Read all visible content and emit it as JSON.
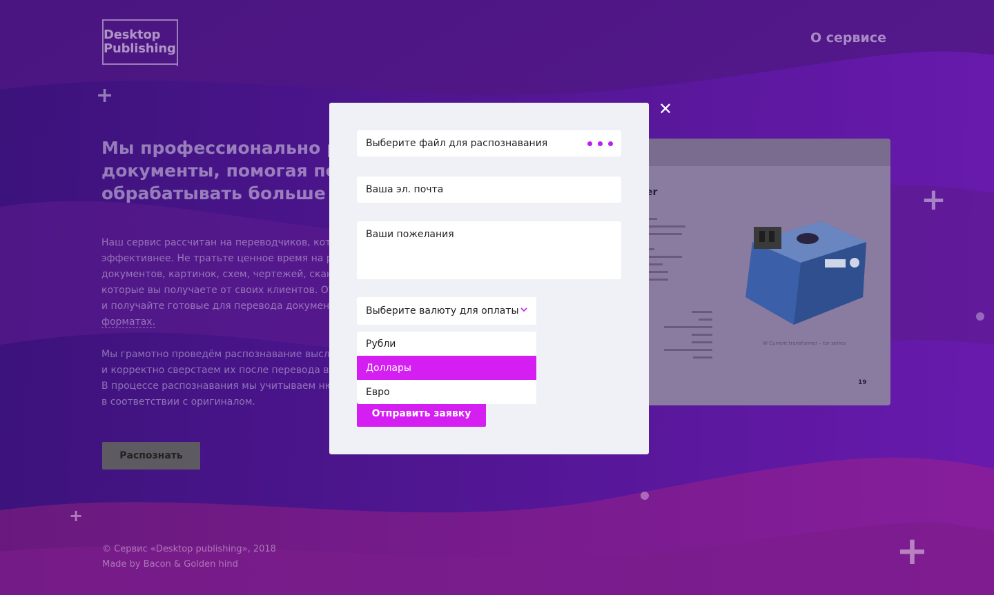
{
  "brand": {
    "logo_line1": "Desktop",
    "logo_line2": "Publishing"
  },
  "nav": {
    "about_label": "О сервисе"
  },
  "hero": {
    "title_lines": [
      "Мы профессионально распознаём",
      "документы, помогая переводчикам",
      "обрабатывать больше заказов"
    ],
    "paragraph1_lines": [
      "Наш сервис рассчитан на переводчиков, которые",
      "эффективнее. Не тратьте ценное время на распознавание",
      "документов, картинок, схем, чертежей, сканов",
      "которые вы получаете от своих клиентов. Отправьте",
      "и получайте готовые для перевода документы",
      "форматах."
    ],
    "paragraph2_lines": [
      "Мы грамотно проведём распознавание высланных",
      "и корректно сверстаем их после перевода в сл",
      "В процессе распознавания мы учитываем нюансы",
      "в соответствии с оригиналом."
    ],
    "button_label": "Распознать"
  },
  "preview": {
    "heading": "er",
    "caption": "W Current transformer – tor series",
    "page_number": "19"
  },
  "footer": {
    "copyright": "© Сервис «Desktop publishing», 2018",
    "made_by": "Made by Bacon & Golden hind"
  },
  "modal": {
    "file_placeholder": "Выберите файл для распознавания",
    "email_placeholder": "Ваша эл. почта",
    "wishes_placeholder": "Ваши пожелания",
    "currency_select_label": "Выберите валюту для оплаты",
    "currency_options": [
      "Рубли",
      "Доллары",
      "Евро"
    ],
    "highlighted_option": "Доллары",
    "submit_label": "Отправить заявку",
    "close_symbol": "✕"
  },
  "colors": {
    "accent": "#d51ef2",
    "modal_bg": "#eff1f6",
    "page_bg": "#3a1370"
  }
}
